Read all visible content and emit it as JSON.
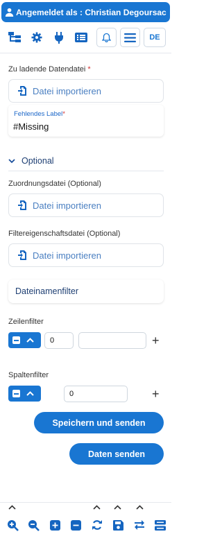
{
  "header": {
    "user_text": "Angemeldet als : Christian Degoursac"
  },
  "toolbar": {
    "icons": [
      "sitemap-icon",
      "gear-icon",
      "plug-icon",
      "list-icon",
      "bell-icon",
      "menu-icon"
    ],
    "language": "DE"
  },
  "form": {
    "data_file": {
      "label": "Zu ladende Datendatei",
      "required_mark": "*",
      "button_text": "Datei importieren"
    },
    "missing_label": {
      "label": "Fehlendes Label",
      "required_mark": "*",
      "value": "#Missing"
    },
    "optional": {
      "title": "Optional",
      "mapping_file": {
        "label": "Zuordnungsdatei (Optional)",
        "button_text": "Datei importieren"
      },
      "filter_property_file": {
        "label": "Filtereigenschaftsdatei (Optional)",
        "button_text": "Datei importieren"
      },
      "filename_filter": "Dateinamenfilter"
    },
    "row_filter": {
      "label": "Zeilenfilter",
      "value": "0",
      "text_value": "",
      "add": "+"
    },
    "column_filter": {
      "label": "Spaltenfilter",
      "value": "0",
      "add": "+"
    },
    "actions": {
      "save_and_send": "Speichern und senden",
      "send_data": "Daten senden"
    }
  },
  "bottombar": {
    "buttons": [
      "zoom-in-icon",
      "zoom-out-icon",
      "plus-square-icon",
      "minus-square-icon",
      "refresh-icon",
      "save-icon",
      "swap-icon",
      "server-icon"
    ]
  },
  "colors": {
    "primary": "#1976d2",
    "required": "#d32f2f",
    "link_text": "#4a7fc1"
  }
}
